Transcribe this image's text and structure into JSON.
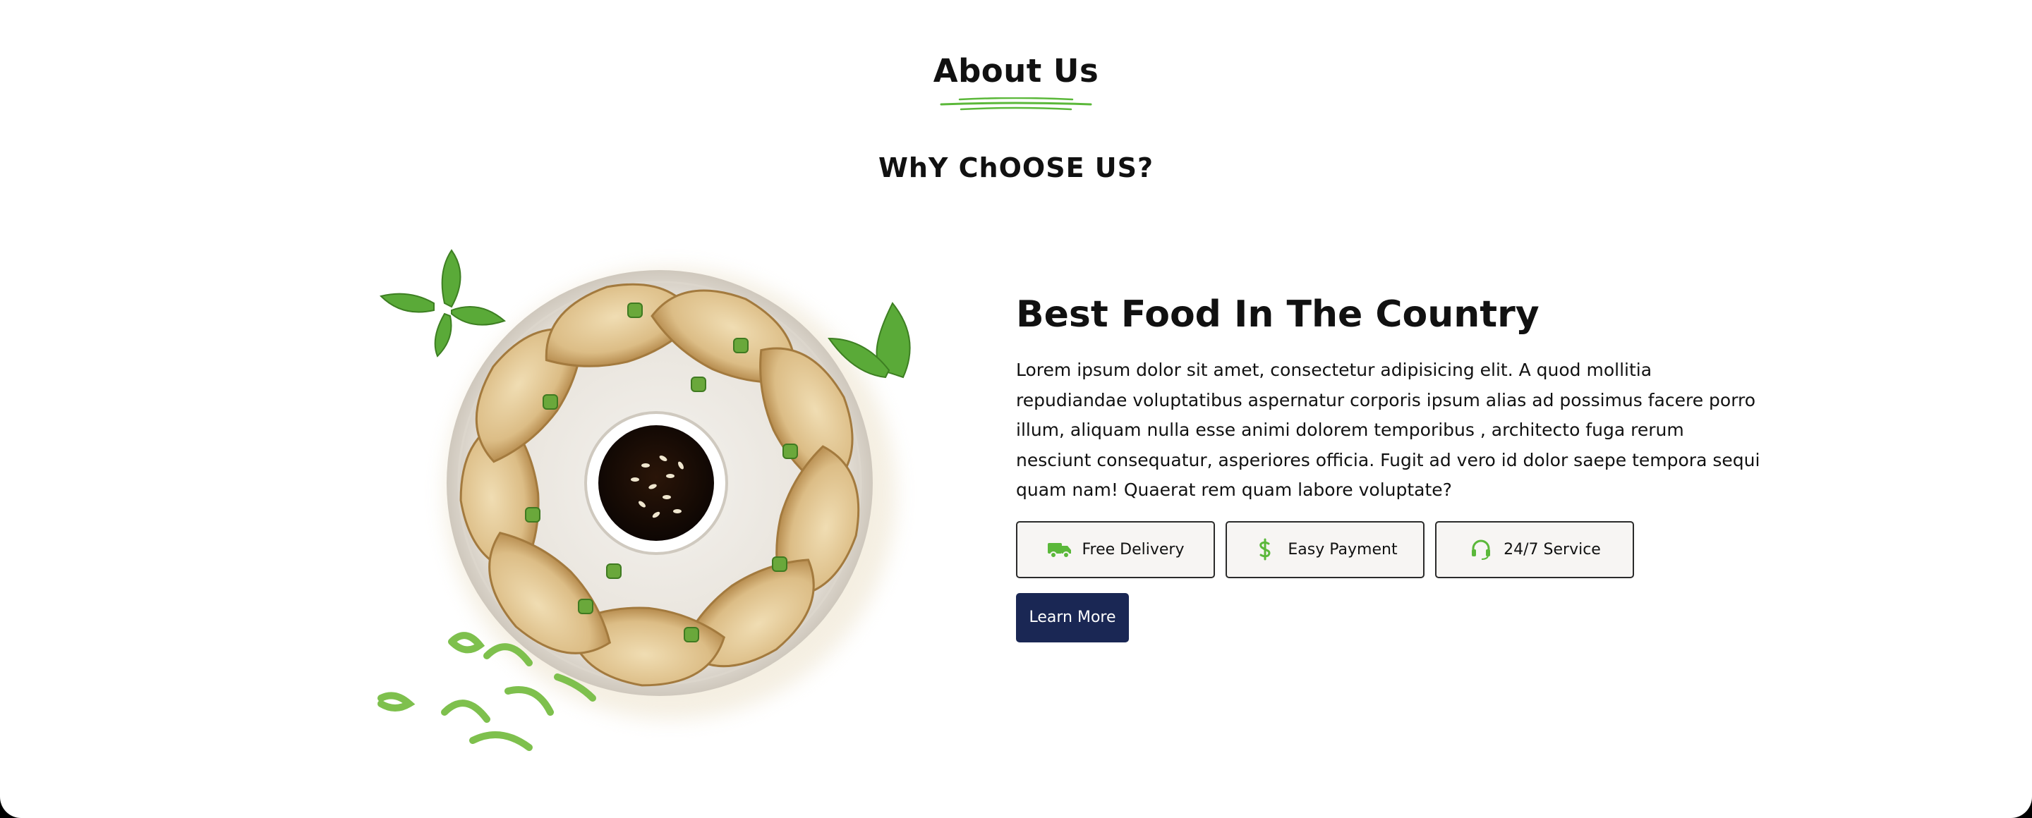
{
  "section": {
    "title": "About Us",
    "subtitle": "WhY ChOOSE US?"
  },
  "about": {
    "heading": "Best Food In The Country",
    "description": "Lorem ipsum dolor sit amet, consectetur adipisicing elit. A quod mollitia repudiandae voluptatibus aspernatur corporis ipsum alias ad possimus facere porro illum, aliquam nulla esse animi dolorem temporibus , architecto fuga rerum nesciunt consequatur, asperiores officia. Fugit ad vero id dolor saepe tempora sequi quam nam! Quaerat rem quam labore voluptate?",
    "features": [
      {
        "label": "Free Delivery",
        "icon": "truck-icon"
      },
      {
        "label": "Easy Payment",
        "icon": "dollar-icon"
      },
      {
        "label": "24/7 Service",
        "icon": "headset-icon"
      }
    ],
    "cta_label": "Learn More"
  },
  "colors": {
    "accent": "#5bb83a",
    "button": "#1a2754",
    "card_bg": "#f7f5f3"
  }
}
